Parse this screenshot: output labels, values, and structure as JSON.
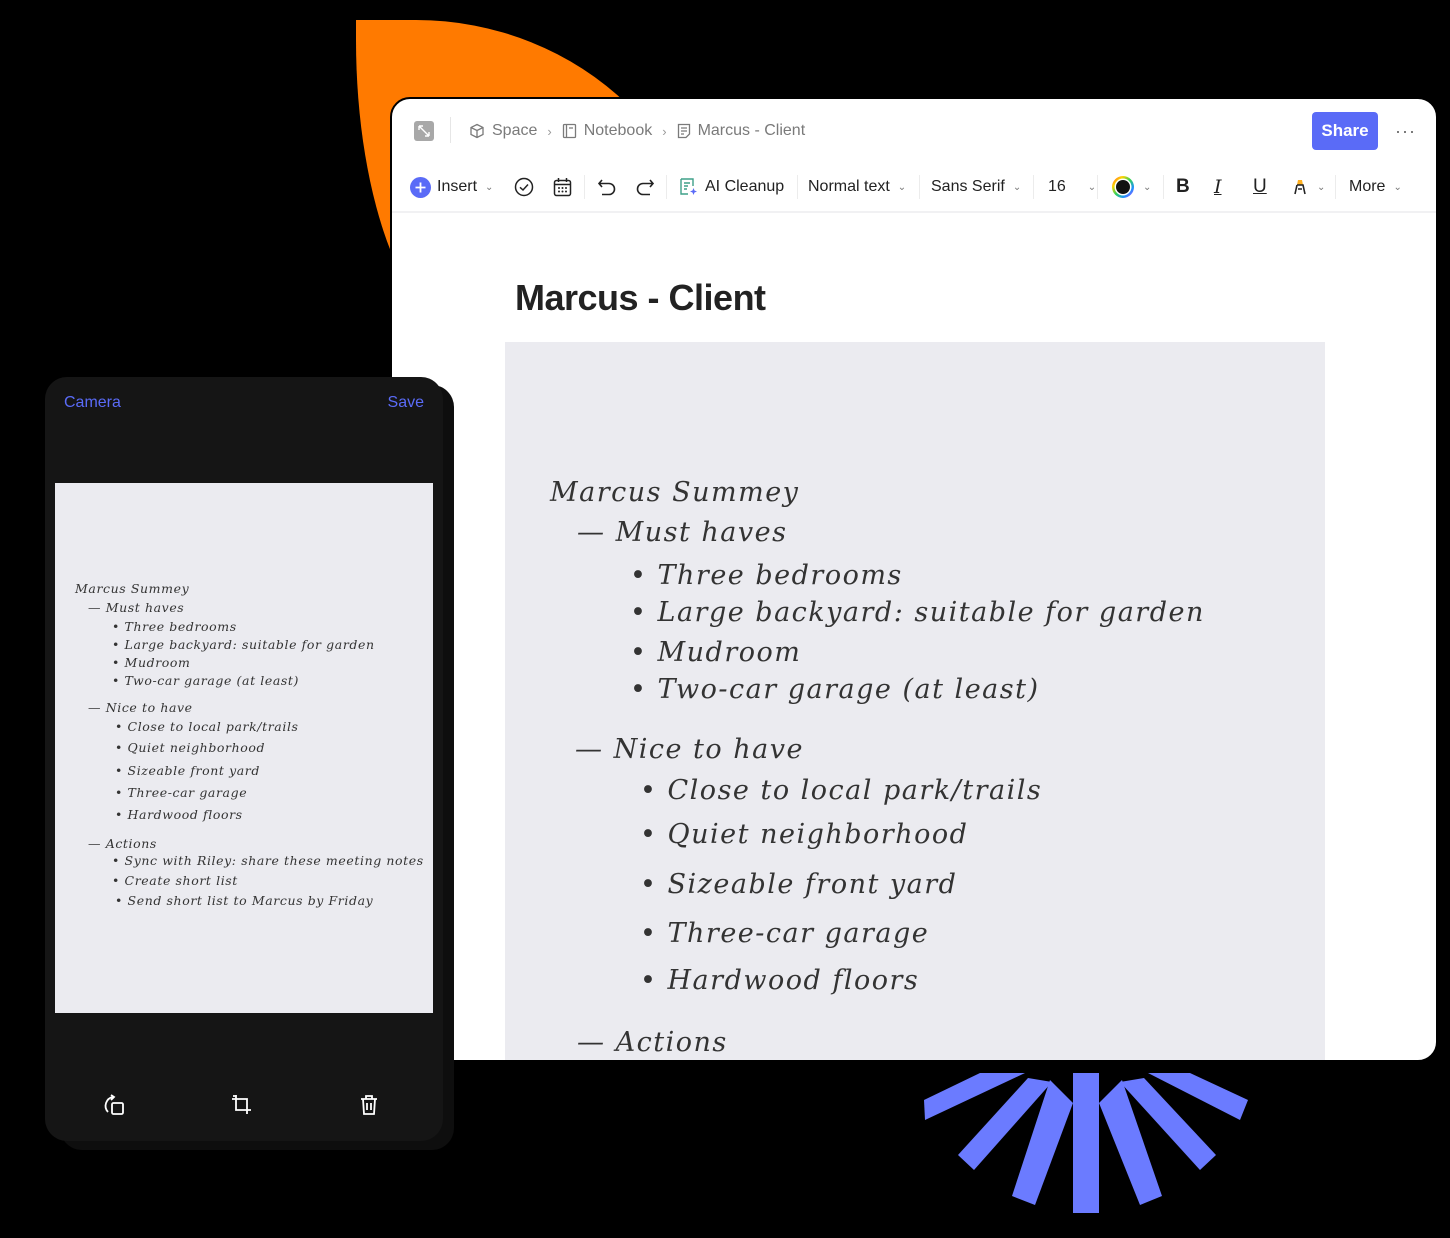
{
  "decor": {
    "orange_color": "#FF7A00",
    "burst_color": "#6B7BFF"
  },
  "editor": {
    "breadcrumb": [
      {
        "icon": "cube-icon",
        "label": "Space"
      },
      {
        "icon": "notebook-icon",
        "label": "Notebook"
      },
      {
        "icon": "document-icon",
        "label": "Marcus - Client"
      }
    ],
    "share_label": "Share",
    "more_options_label": "···",
    "accent_color": "#5A6BF7",
    "toolbar": {
      "insert_label": "Insert",
      "ai_cleanup_label": "AI Cleanup",
      "text_style": "Normal text",
      "font_family": "Sans Serif",
      "font_size": "16",
      "text_color": "#000000",
      "bold_label": "B",
      "italic_label": "I",
      "underline_label": "U",
      "more_label": "More"
    },
    "doc_title": "Marcus - Client"
  },
  "note": {
    "heading": "Marcus Summey",
    "sections": [
      {
        "title": "Must haves",
        "items": [
          "Three bedrooms",
          "Large backyard: suitable for garden",
          "Mudroom",
          "Two-car garage (at least)"
        ]
      },
      {
        "title": "Nice to have",
        "items": [
          "Close to local park/trails",
          "Quiet neighborhood",
          "Sizeable front yard",
          "Three-car garage",
          "Hardwood floors"
        ]
      },
      {
        "title": "Actions",
        "items": [
          "Sync with Riley: share these meeting notes",
          "Create short list",
          "Send short list to Marcus by Friday"
        ]
      }
    ]
  },
  "phone": {
    "camera_label": "Camera",
    "save_label": "Save",
    "tools": [
      "rotate-icon",
      "crop-icon",
      "trash-icon"
    ]
  }
}
